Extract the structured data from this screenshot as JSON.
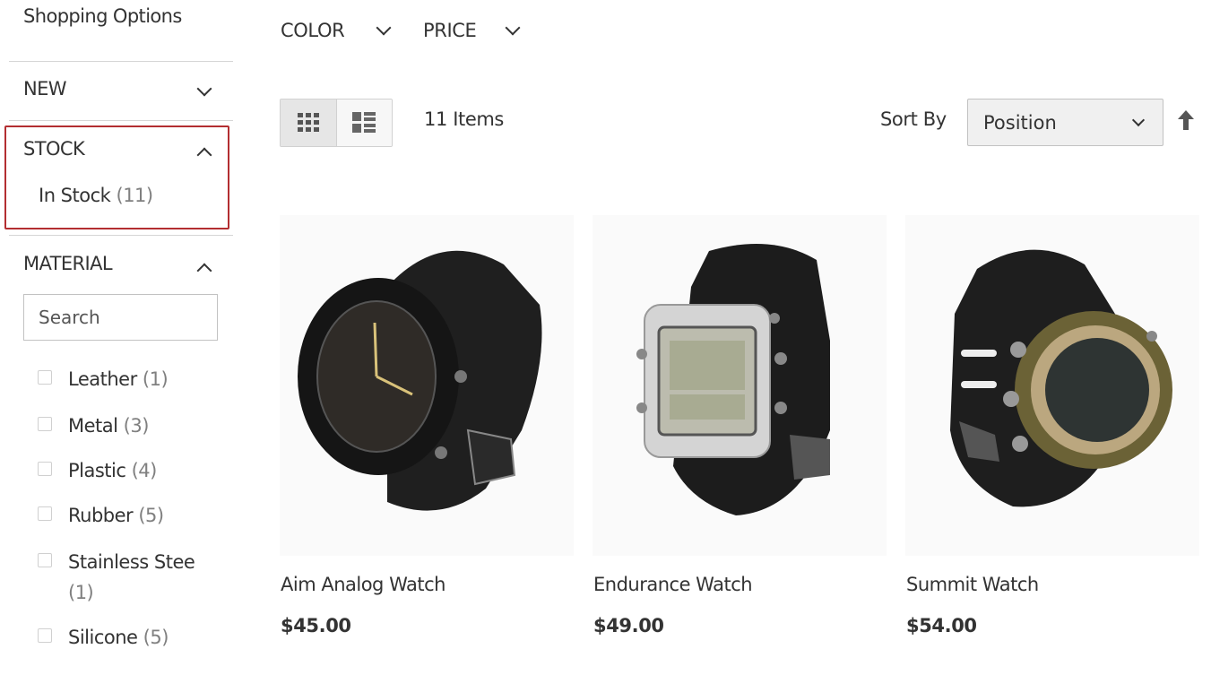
{
  "sidebar": {
    "title": "Shopping Options",
    "filters": {
      "new": {
        "label": "NEW"
      },
      "stock": {
        "label": "STOCK",
        "items": [
          {
            "label": "In Stock",
            "count": "(11)"
          }
        ]
      },
      "material": {
        "label": "MATERIAL",
        "search_placeholder": "Search",
        "options": [
          {
            "label": "Leather",
            "count": "(1)"
          },
          {
            "label": "Metal",
            "count": "(3)"
          },
          {
            "label": "Plastic",
            "count": "(4)"
          },
          {
            "label": "Rubber",
            "count": "(5)"
          },
          {
            "label": "Stainless Stee",
            "count": "(1)"
          },
          {
            "label": "Silicone",
            "count": "(5)"
          }
        ]
      }
    }
  },
  "top_filters": {
    "color": "COLOR",
    "price": "PRICE"
  },
  "toolbar": {
    "items_count": "11 Items",
    "sort_by_label": "Sort By",
    "sort_value": "Position",
    "view_modes": [
      "grid-icon",
      "list-icon"
    ],
    "sort_direction_icon": "arrow-up-icon"
  },
  "products": [
    {
      "name": "Aim Analog Watch",
      "price": "$45.00"
    },
    {
      "name": "Endurance Watch",
      "price": "$49.00"
    },
    {
      "name": "Summit Watch",
      "price": "$54.00"
    }
  ],
  "colors": {
    "highlight_border": "#b32e31",
    "text": "#333333",
    "muted": "#808080"
  }
}
